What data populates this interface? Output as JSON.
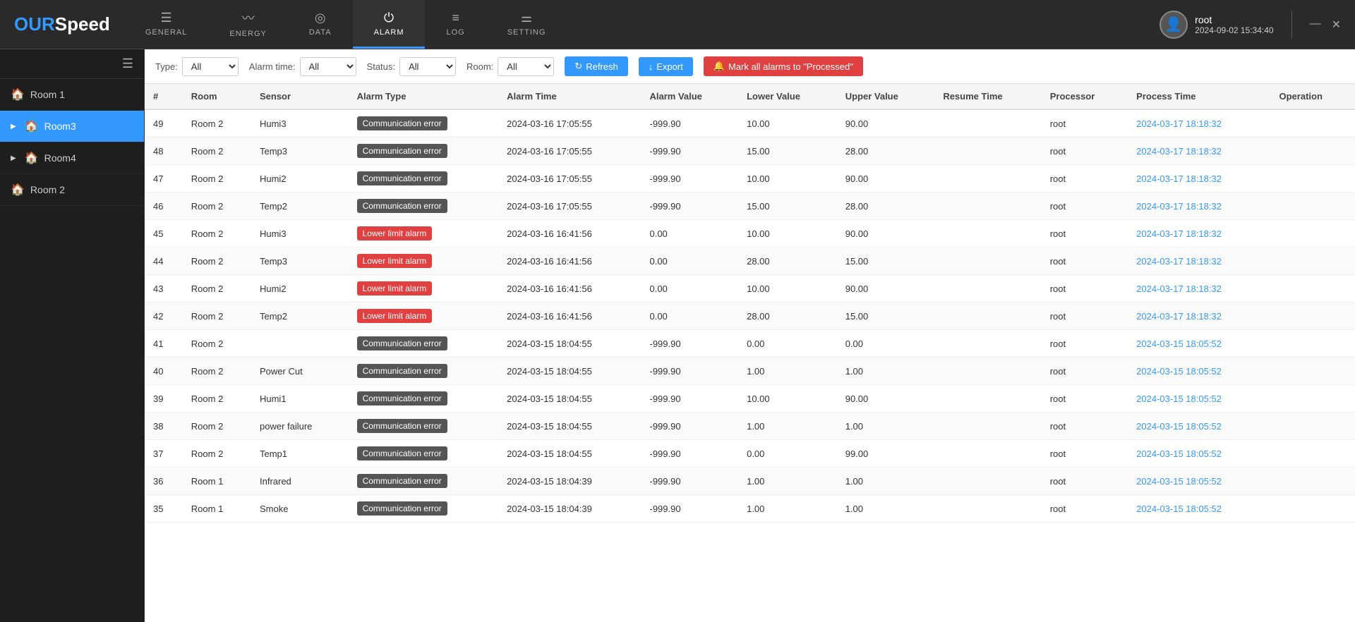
{
  "app": {
    "logo_our": "OUR",
    "logo_speed": "Speed"
  },
  "header": {
    "user": {
      "name": "root",
      "datetime": "2024-09-02 15:34:40"
    },
    "nav": [
      {
        "id": "general",
        "icon": "☰",
        "label": "GENERAL",
        "active": false
      },
      {
        "id": "energy",
        "icon": "〰",
        "label": "ENERGY",
        "active": false
      },
      {
        "id": "data",
        "icon": "◎",
        "label": "DATA",
        "active": false
      },
      {
        "id": "alarm",
        "icon": "⏻",
        "label": "ALARM",
        "active": true
      },
      {
        "id": "log",
        "icon": "≡",
        "label": "LOG",
        "active": false
      },
      {
        "id": "setting",
        "icon": "⚌",
        "label": "SETTING",
        "active": false
      }
    ],
    "win_min": "—",
    "win_close": "✕"
  },
  "sidebar": {
    "rooms": [
      {
        "id": "room1",
        "label": "Room 1",
        "active": false,
        "expandable": false
      },
      {
        "id": "room3",
        "label": "Room3",
        "active": true,
        "expandable": true
      },
      {
        "id": "room4",
        "label": "Room4",
        "active": false,
        "expandable": true
      },
      {
        "id": "room2",
        "label": "Room 2",
        "active": false,
        "expandable": false
      }
    ]
  },
  "filters": {
    "type_label": "Type:",
    "type_value": "All",
    "alarm_time_label": "Alarm time:",
    "alarm_time_value": "All",
    "status_label": "Status:",
    "status_value": "All",
    "room_label": "Room:",
    "room_value": "All",
    "refresh_label": "Refresh",
    "export_label": "Export",
    "mark_label": "Mark all alarms to \"Processed\""
  },
  "table": {
    "columns": [
      "#",
      "Room",
      "Sensor",
      "Alarm Type",
      "Alarm Time",
      "Alarm Value",
      "Lower Value",
      "Upper Value",
      "Resume Time",
      "Processor",
      "Process Time",
      "Operation"
    ],
    "rows": [
      {
        "num": 49,
        "room": "Room 2",
        "sensor": "Humi3",
        "alarm_type": "Communication error",
        "alarm_type_class": "comm",
        "alarm_time": "2024-03-16 17:05:55",
        "alarm_value": "-999.90",
        "lower_value": "10.00",
        "upper_value": "90.00",
        "resume_time": "",
        "processor": "root",
        "process_time": "2024-03-17 18:18:32"
      },
      {
        "num": 48,
        "room": "Room 2",
        "sensor": "Temp3",
        "alarm_type": "Communication error",
        "alarm_type_class": "comm",
        "alarm_time": "2024-03-16 17:05:55",
        "alarm_value": "-999.90",
        "lower_value": "15.00",
        "upper_value": "28.00",
        "resume_time": "",
        "processor": "root",
        "process_time": "2024-03-17 18:18:32"
      },
      {
        "num": 47,
        "room": "Room 2",
        "sensor": "Humi2",
        "alarm_type": "Communication error",
        "alarm_type_class": "comm",
        "alarm_time": "2024-03-16 17:05:55",
        "alarm_value": "-999.90",
        "lower_value": "10.00",
        "upper_value": "90.00",
        "resume_time": "",
        "processor": "root",
        "process_time": "2024-03-17 18:18:32"
      },
      {
        "num": 46,
        "room": "Room 2",
        "sensor": "Temp2",
        "alarm_type": "Communication error",
        "alarm_type_class": "comm",
        "alarm_time": "2024-03-16 17:05:55",
        "alarm_value": "-999.90",
        "lower_value": "15.00",
        "upper_value": "28.00",
        "resume_time": "",
        "processor": "root",
        "process_time": "2024-03-17 18:18:32"
      },
      {
        "num": 45,
        "room": "Room 2",
        "sensor": "Humi3",
        "alarm_type": "Lower limit alarm",
        "alarm_type_class": "lower",
        "alarm_time": "2024-03-16 16:41:56",
        "alarm_value": "0.00",
        "lower_value": "10.00",
        "upper_value": "90.00",
        "resume_time": "",
        "processor": "root",
        "process_time": "2024-03-17 18:18:32"
      },
      {
        "num": 44,
        "room": "Room 2",
        "sensor": "Temp3",
        "alarm_type": "Lower limit alarm",
        "alarm_type_class": "lower",
        "alarm_time": "2024-03-16 16:41:56",
        "alarm_value": "0.00",
        "lower_value": "28.00",
        "upper_value": "15.00",
        "resume_time": "",
        "processor": "root",
        "process_time": "2024-03-17 18:18:32"
      },
      {
        "num": 43,
        "room": "Room 2",
        "sensor": "Humi2",
        "alarm_type": "Lower limit alarm",
        "alarm_type_class": "lower",
        "alarm_time": "2024-03-16 16:41:56",
        "alarm_value": "0.00",
        "lower_value": "10.00",
        "upper_value": "90.00",
        "resume_time": "",
        "processor": "root",
        "process_time": "2024-03-17 18:18:32"
      },
      {
        "num": 42,
        "room": "Room 2",
        "sensor": "Temp2",
        "alarm_type": "Lower limit alarm",
        "alarm_type_class": "lower",
        "alarm_time": "2024-03-16 16:41:56",
        "alarm_value": "0.00",
        "lower_value": "28.00",
        "upper_value": "15.00",
        "resume_time": "",
        "processor": "root",
        "process_time": "2024-03-17 18:18:32"
      },
      {
        "num": 41,
        "room": "Room 2",
        "sensor": "",
        "alarm_type": "Communication error",
        "alarm_type_class": "comm",
        "alarm_time": "2024-03-15 18:04:55",
        "alarm_value": "-999.90",
        "lower_value": "0.00",
        "upper_value": "0.00",
        "resume_time": "",
        "processor": "root",
        "process_time": "2024-03-15 18:05:52"
      },
      {
        "num": 40,
        "room": "Room 2",
        "sensor": "Power Cut",
        "alarm_type": "Communication error",
        "alarm_type_class": "comm",
        "alarm_time": "2024-03-15 18:04:55",
        "alarm_value": "-999.90",
        "lower_value": "1.00",
        "upper_value": "1.00",
        "resume_time": "",
        "processor": "root",
        "process_time": "2024-03-15 18:05:52"
      },
      {
        "num": 39,
        "room": "Room 2",
        "sensor": "Humi1",
        "alarm_type": "Communication error",
        "alarm_type_class": "comm",
        "alarm_time": "2024-03-15 18:04:55",
        "alarm_value": "-999.90",
        "lower_value": "10.00",
        "upper_value": "90.00",
        "resume_time": "",
        "processor": "root",
        "process_time": "2024-03-15 18:05:52"
      },
      {
        "num": 38,
        "room": "Room 2",
        "sensor": "power failure",
        "alarm_type": "Communication error",
        "alarm_type_class": "comm",
        "alarm_time": "2024-03-15 18:04:55",
        "alarm_value": "-999.90",
        "lower_value": "1.00",
        "upper_value": "1.00",
        "resume_time": "",
        "processor": "root",
        "process_time": "2024-03-15 18:05:52"
      },
      {
        "num": 37,
        "room": "Room 2",
        "sensor": "Temp1",
        "alarm_type": "Communication error",
        "alarm_type_class": "comm",
        "alarm_time": "2024-03-15 18:04:55",
        "alarm_value": "-999.90",
        "lower_value": "0.00",
        "upper_value": "99.00",
        "resume_time": "",
        "processor": "root",
        "process_time": "2024-03-15 18:05:52"
      },
      {
        "num": 36,
        "room": "Room 1",
        "sensor": "Infrared",
        "alarm_type": "Communication error",
        "alarm_type_class": "comm",
        "alarm_time": "2024-03-15 18:04:39",
        "alarm_value": "-999.90",
        "lower_value": "1.00",
        "upper_value": "1.00",
        "resume_time": "",
        "processor": "root",
        "process_time": "2024-03-15 18:05:52"
      },
      {
        "num": 35,
        "room": "Room 1",
        "sensor": "Smoke",
        "alarm_type": "Communication error",
        "alarm_type_class": "comm",
        "alarm_time": "2024-03-15 18:04:39",
        "alarm_value": "-999.90",
        "lower_value": "1.00",
        "upper_value": "1.00",
        "resume_time": "",
        "processor": "root",
        "process_time": "2024-03-15 18:05:52"
      }
    ]
  }
}
